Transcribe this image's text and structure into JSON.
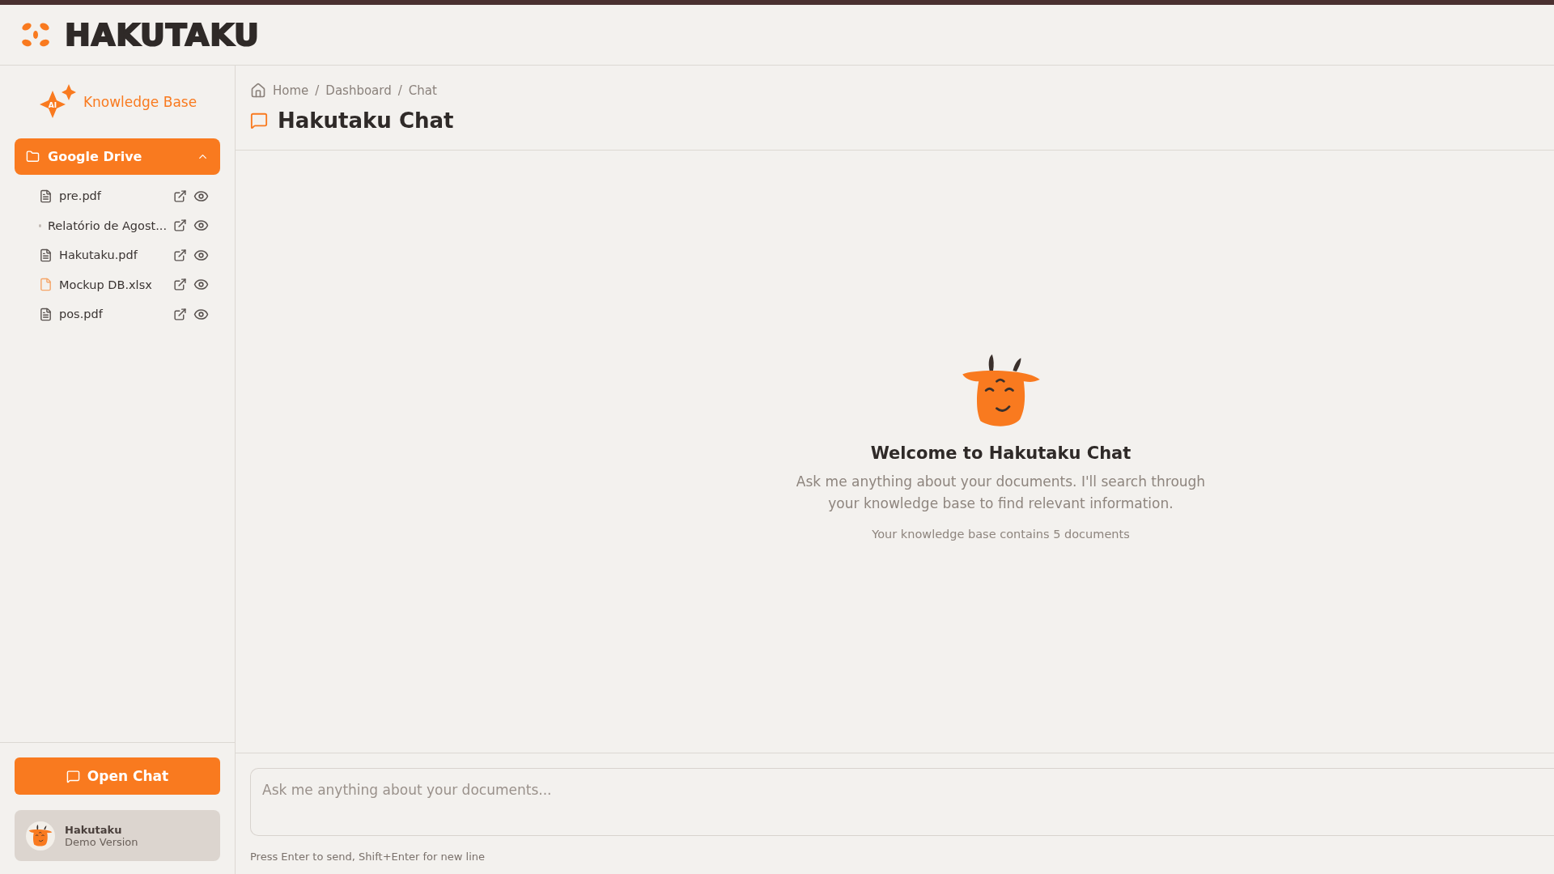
{
  "header": {
    "logo_text": "HAKUTAKU"
  },
  "sidebar": {
    "ai_badge": "AI",
    "title": "Knowledge Base",
    "source": {
      "label": "Google Drive",
      "expanded": true
    },
    "files": [
      {
        "name": "pre.pdf",
        "kind": "doc"
      },
      {
        "name": "Relatório de Agost...",
        "kind": "other"
      },
      {
        "name": "Hakutaku.pdf",
        "kind": "doc"
      },
      {
        "name": "Mockup DB.xlsx",
        "kind": "sheet"
      },
      {
        "name": "pos.pdf",
        "kind": "doc"
      }
    ],
    "open_chat_button": "Open Chat",
    "user": {
      "name": "Hakutaku",
      "plan": "Demo Version"
    }
  },
  "breadcrumb": {
    "separator": "/",
    "items": [
      "Home",
      "Dashboard",
      "Chat"
    ]
  },
  "page_title": "Hakutaku Chat",
  "welcome": {
    "title": "Welcome to Hakutaku Chat",
    "text": "Ask me anything about your documents. I'll search through your knowledge base to find relevant information.",
    "count": "Your knowledge base contains 5 documents"
  },
  "input": {
    "placeholder": "Ask me anything about your documents...",
    "hint": "Press Enter to send, Shift+Enter for new line"
  }
}
